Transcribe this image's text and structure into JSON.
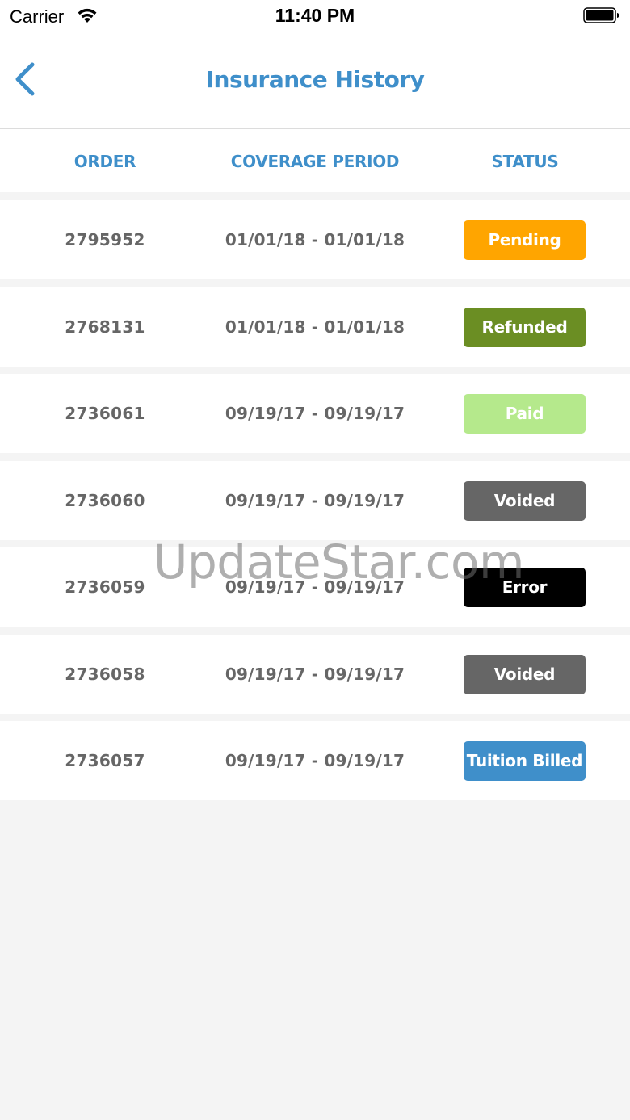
{
  "status_bar": {
    "carrier": "Carrier",
    "time": "11:40 PM",
    "wifi_icon": "wifi-icon",
    "battery_icon": "battery-icon"
  },
  "nav": {
    "title": "Insurance History",
    "back_icon": "chevron-left-icon"
  },
  "columns": {
    "order": "ORDER",
    "period": "COVERAGE PERIOD",
    "status": "STATUS"
  },
  "rows": [
    {
      "order": "2795952",
      "period": "01/01/18 - 01/01/18",
      "status": "Pending",
      "status_color": "#ffa500"
    },
    {
      "order": "2768131",
      "period": "01/01/18 - 01/01/18",
      "status": "Refunded",
      "status_color": "#6b8e23"
    },
    {
      "order": "2736061",
      "period": "09/19/17 - 09/19/17",
      "status": "Paid",
      "status_color": "#b5e98c"
    },
    {
      "order": "2736060",
      "period": "09/19/17 - 09/19/17",
      "status": "Voided",
      "status_color": "#666666"
    },
    {
      "order": "2736059",
      "period": "09/19/17 - 09/19/17",
      "status": "Error",
      "status_color": "#000000"
    },
    {
      "order": "2736058",
      "period": "09/19/17 - 09/19/17",
      "status": "Voided",
      "status_color": "#666666"
    },
    {
      "order": "2736057",
      "period": "09/19/17 - 09/19/17",
      "status": "Tuition Billed",
      "status_color": "#3f8fca"
    }
  ],
  "colors": {
    "accent": "#3f8fca",
    "text_secondary": "#666666",
    "background": "#f4f4f4"
  },
  "watermark": "UpdateStar.com"
}
